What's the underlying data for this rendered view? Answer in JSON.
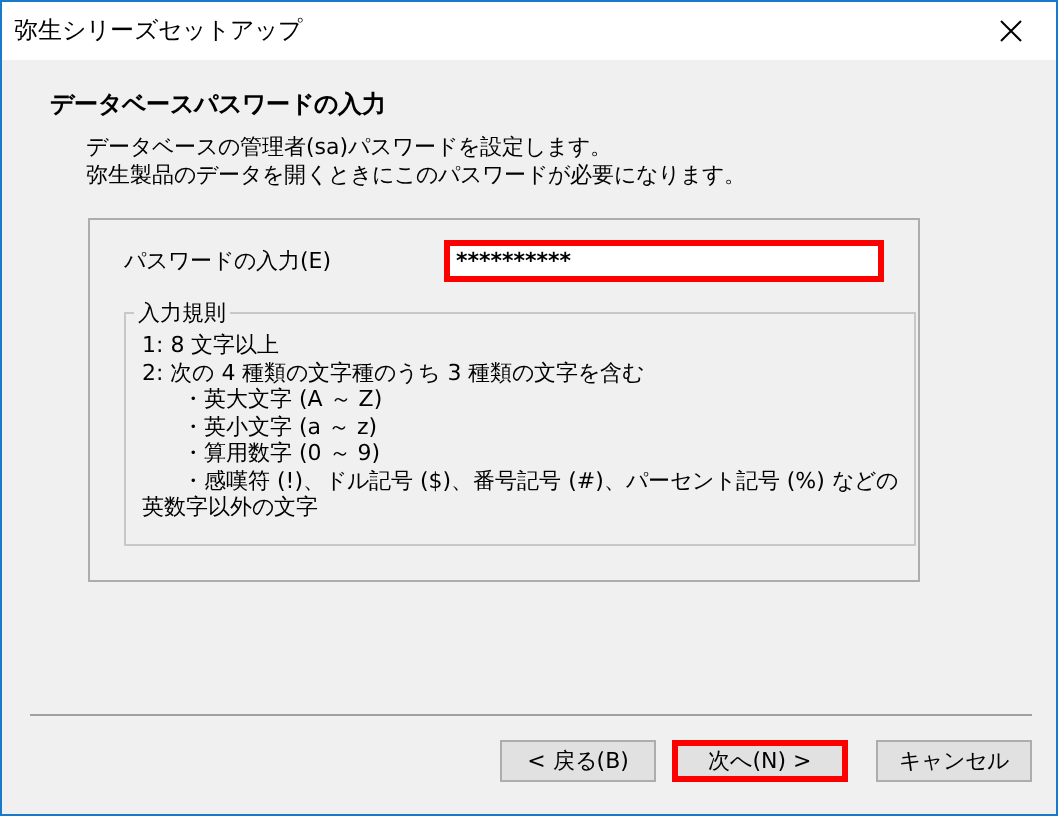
{
  "window": {
    "title": "弥生シリーズセットアップ"
  },
  "header": {
    "title": "データベースパスワードの入力",
    "description": [
      "データベースの管理者(sa)パスワードを設定します。",
      "弥生製品のデータを開くときにこのパスワードが必要になります。"
    ]
  },
  "password_field": {
    "label": "パスワードの入力(E)",
    "value": "**********",
    "highlighted": true
  },
  "rules": {
    "title": "入力規則",
    "lines": [
      {
        "kind": "line",
        "text": "1: 8 文字以上"
      },
      {
        "kind": "line",
        "text": "2: 次の 4 種類の文字種のうち 3 種類の文字を含む"
      },
      {
        "kind": "sub",
        "text": "・英大文字 (A ～ Z)"
      },
      {
        "kind": "sub",
        "text": "・英小文字 (a ～ z)"
      },
      {
        "kind": "sub",
        "text": "・算用数字 (0 ～ 9)"
      },
      {
        "kind": "sub",
        "text": "・感嘆符 (!)、ドル記号 ($)、番号記号 (#)、パーセント記号 (%) などの"
      },
      {
        "kind": "line",
        "text": "英数字以外の文字"
      }
    ]
  },
  "buttons": [
    {
      "label": "< 戻る(B)",
      "highlighted": false
    },
    {
      "label": "次へ(N) >",
      "highlighted": true
    },
    {
      "label": "キャンセル",
      "highlighted": false
    }
  ]
}
